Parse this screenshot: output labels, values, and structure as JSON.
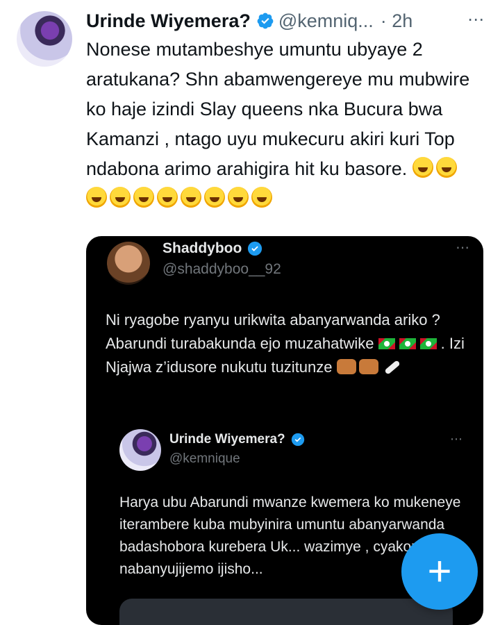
{
  "tweet": {
    "author_name": "Urinde Wiyemera?",
    "author_handle": "@kemniq...",
    "timestamp": "· 2h",
    "text": "Nonese mutambeshye umuntu ubyaye 2 aratukana? Shn abamwengereye mu mubwire ko haje izindi Slay queens nka Bucura bwa Kamanzi , ntago uyu mukecuru akiri kuri Top ndabona arimo arahigira hit ku basore.",
    "emoji_count": 10,
    "emoji_name": "rolling-on-floor-laughing-emoji"
  },
  "quoted": {
    "author_name": "Shaddyboo",
    "author_handle": "@shaddyboo__92",
    "text_part1": "Ni ryagobe ryanyu urikwita abanyarwanda ariko ?  Abarundi turabakunda ejo muzahatwike",
    "text_part2": ". Izi Njajwa z’idusore nukutu tuzitunze",
    "inner": {
      "author_name": "Urinde Wiyemera?",
      "author_handle": "@kemnique",
      "text": "Harya ubu Abarundi mwanze kwemera ko mukeneye iterambere kuba mubyinira umuntu abanyarwanda badashobora kurebera Uk... wazimye , cyakoze nabanyujijemo ijisho..."
    }
  },
  "fab": {
    "icon": "plus-icon",
    "color": "#1d9bf0"
  },
  "colors": {
    "verified": "#1d9bf0",
    "card_bg": "#000000"
  }
}
